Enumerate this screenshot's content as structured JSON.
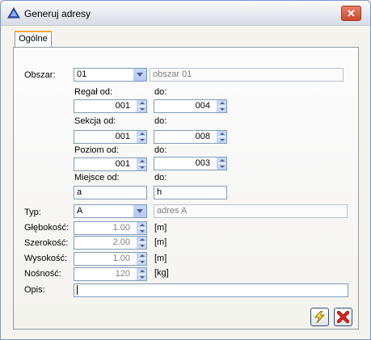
{
  "window": {
    "title": "Generuj adresy",
    "close_glyph": "✕"
  },
  "tabs": [
    {
      "label": "Ogólne",
      "active": true
    }
  ],
  "obszar": {
    "label": "Obszar:",
    "value": "01",
    "description": "obszar 01"
  },
  "regal": {
    "from_label": "Regał od:",
    "from_value": "001",
    "to_label": "do:",
    "to_value": "004"
  },
  "sekcja": {
    "from_label": "Sekcja od:",
    "from_value": "001",
    "to_label": "do:",
    "to_value": "008"
  },
  "poziom": {
    "from_label": "Poziom od:",
    "from_value": "001",
    "to_label": "do:",
    "to_value": "003"
  },
  "miejsce": {
    "from_label": "Miejsce od:",
    "from_value": "a",
    "to_label": "do:",
    "to_value": "h"
  },
  "typ": {
    "label": "Typ:",
    "value": "A",
    "description": "adres A"
  },
  "glebokosc": {
    "label": "Głębokość:",
    "value": "1.00",
    "unit": "[m]"
  },
  "szerokosc": {
    "label": "Szerokość:",
    "value": "2.00",
    "unit": "[m]"
  },
  "wysokosc": {
    "label": "Wysokość:",
    "value": "1.00",
    "unit": "[m]"
  },
  "nosnosc": {
    "label": "Nośność:",
    "value": "120",
    "unit": "[kg]"
  },
  "opis": {
    "label": "Opis:",
    "value": ""
  },
  "icons": {
    "title": "triangle-app-icon",
    "confirm": "lightning-icon",
    "cancel": "red-x-icon"
  },
  "colors": {
    "confirm_accent": "#e8b800",
    "cancel_accent": "#d0201a",
    "tab_highlight": "#f4a53c"
  }
}
